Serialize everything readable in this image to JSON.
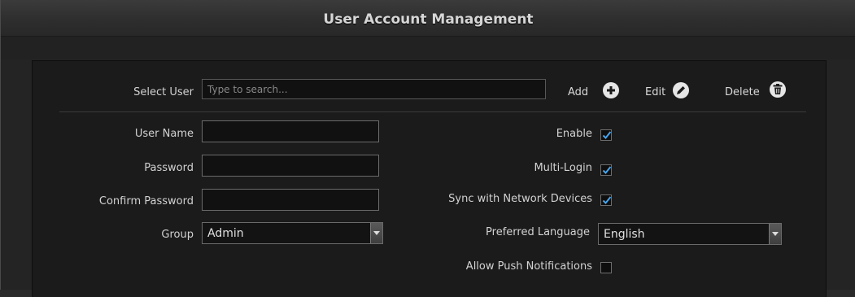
{
  "window": {
    "title": "User Account Management"
  },
  "toolbar": {
    "select_user_label": "Select User",
    "search_placeholder": "Type to search...",
    "add_label": "Add",
    "edit_label": "Edit",
    "delete_label": "Delete",
    "add_icon": "plus-circle-icon",
    "edit_icon": "pencil-circle-icon",
    "delete_icon": "trash-circle-icon"
  },
  "form": {
    "user_name_label": "User Name",
    "user_name_value": "",
    "password_label": "Password",
    "password_value": "",
    "confirm_password_label": "Confirm Password",
    "confirm_password_value": "",
    "group_label": "Group",
    "group_value": "Admin",
    "enable_label": "Enable",
    "enable_checked": true,
    "multi_login_label": "Multi-Login",
    "multi_login_checked": true,
    "sync_label": "Sync with Network Devices",
    "sync_checked": true,
    "preferred_language_label": "Preferred Language",
    "preferred_language_value": "English",
    "push_notifications_label": "Allow Push Notifications",
    "push_notifications_checked": false
  },
  "colors": {
    "check_mark": "#4aa3e8",
    "panel_bg": "#1b1b1b",
    "titlebar_text": "#d6d6d6"
  }
}
